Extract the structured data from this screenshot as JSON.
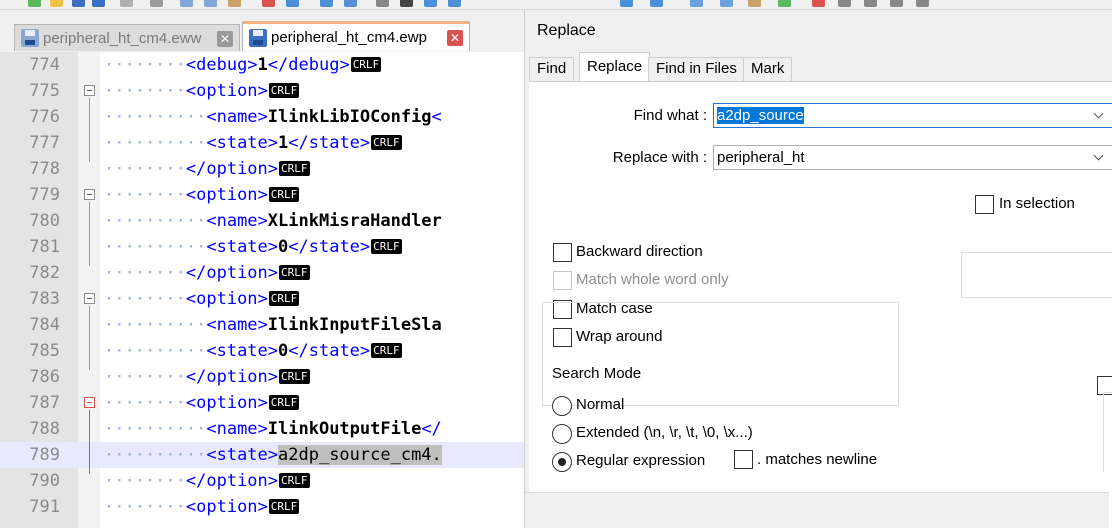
{
  "tabs": [
    {
      "label": "peripheral_ht_cm4.eww",
      "active": false
    },
    {
      "label": "peripheral_ht_cm4.ewp",
      "active": true
    }
  ],
  "editor": {
    "lines": [
      {
        "num": "774",
        "parts": [
          {
            "t": "dots",
            "v": "········"
          },
          {
            "t": "tag",
            "v": "<debug>"
          },
          {
            "t": "bold",
            "v": "1"
          },
          {
            "t": "tag",
            "v": "</debug>"
          },
          {
            "t": "crlf",
            "v": "CRLF"
          }
        ]
      },
      {
        "num": "775",
        "parts": [
          {
            "t": "dots",
            "v": "········"
          },
          {
            "t": "tag",
            "v": "<option>"
          },
          {
            "t": "crlf",
            "v": "CRLF"
          }
        ]
      },
      {
        "num": "776",
        "parts": [
          {
            "t": "dots",
            "v": "··········"
          },
          {
            "t": "tag",
            "v": "<name>"
          },
          {
            "t": "bold",
            "v": "IlinkLibIOConfig"
          },
          {
            "t": "tag",
            "v": "<"
          }
        ]
      },
      {
        "num": "777",
        "parts": [
          {
            "t": "dots",
            "v": "··········"
          },
          {
            "t": "tag",
            "v": "<state>"
          },
          {
            "t": "bold",
            "v": "1"
          },
          {
            "t": "tag",
            "v": "</state>"
          },
          {
            "t": "crlf",
            "v": "CRLF"
          }
        ]
      },
      {
        "num": "778",
        "parts": [
          {
            "t": "dots",
            "v": "········"
          },
          {
            "t": "tag",
            "v": "</option>"
          },
          {
            "t": "crlf",
            "v": "CRLF"
          }
        ]
      },
      {
        "num": "779",
        "parts": [
          {
            "t": "dots",
            "v": "········"
          },
          {
            "t": "tag",
            "v": "<option>"
          },
          {
            "t": "crlf",
            "v": "CRLF"
          }
        ]
      },
      {
        "num": "780",
        "parts": [
          {
            "t": "dots",
            "v": "··········"
          },
          {
            "t": "tag",
            "v": "<name>"
          },
          {
            "t": "bold",
            "v": "XLinkMisraHandler"
          }
        ]
      },
      {
        "num": "781",
        "parts": [
          {
            "t": "dots",
            "v": "··········"
          },
          {
            "t": "tag",
            "v": "<state>"
          },
          {
            "t": "bold",
            "v": "0"
          },
          {
            "t": "tag",
            "v": "</state>"
          },
          {
            "t": "crlf",
            "v": "CRLF"
          }
        ]
      },
      {
        "num": "782",
        "parts": [
          {
            "t": "dots",
            "v": "········"
          },
          {
            "t": "tag",
            "v": "</option>"
          },
          {
            "t": "crlf",
            "v": "CRLF"
          }
        ]
      },
      {
        "num": "783",
        "parts": [
          {
            "t": "dots",
            "v": "········"
          },
          {
            "t": "tag",
            "v": "<option>"
          },
          {
            "t": "crlf",
            "v": "CRLF"
          }
        ]
      },
      {
        "num": "784",
        "parts": [
          {
            "t": "dots",
            "v": "··········"
          },
          {
            "t": "tag",
            "v": "<name>"
          },
          {
            "t": "bold",
            "v": "IlinkInputFileSla"
          }
        ]
      },
      {
        "num": "785",
        "parts": [
          {
            "t": "dots",
            "v": "··········"
          },
          {
            "t": "tag",
            "v": "<state>"
          },
          {
            "t": "bold",
            "v": "0"
          },
          {
            "t": "tag",
            "v": "</state>"
          },
          {
            "t": "crlf",
            "v": "CRLF"
          }
        ]
      },
      {
        "num": "786",
        "parts": [
          {
            "t": "dots",
            "v": "········"
          },
          {
            "t": "tag",
            "v": "</option>"
          },
          {
            "t": "crlf",
            "v": "CRLF"
          }
        ]
      },
      {
        "num": "787",
        "parts": [
          {
            "t": "dots",
            "v": "········"
          },
          {
            "t": "tag",
            "v": "<option>"
          },
          {
            "t": "crlf",
            "v": "CRLF"
          }
        ]
      },
      {
        "num": "788",
        "parts": [
          {
            "t": "dots",
            "v": "··········"
          },
          {
            "t": "tag",
            "v": "<name>"
          },
          {
            "t": "bold",
            "v": "IlinkOutputFile"
          },
          {
            "t": "tag",
            "v": "</"
          }
        ]
      },
      {
        "num": "789",
        "parts": [
          {
            "t": "dots",
            "v": "··········"
          },
          {
            "t": "tag",
            "v": "<state>"
          },
          {
            "t": "hl",
            "v": "a2dp_source_cm4."
          }
        ]
      },
      {
        "num": "790",
        "parts": [
          {
            "t": "dots",
            "v": "········"
          },
          {
            "t": "tag",
            "v": "</option>"
          },
          {
            "t": "crlf",
            "v": "CRLF"
          }
        ]
      },
      {
        "num": "791",
        "parts": [
          {
            "t": "dots",
            "v": "········"
          },
          {
            "t": "tag",
            "v": "<option>"
          },
          {
            "t": "crlf",
            "v": "CRLF"
          }
        ]
      }
    ]
  },
  "dialog": {
    "title": "Replace",
    "tabs": [
      "Find",
      "Replace",
      "Find in Files",
      "Mark"
    ],
    "find_label": "Find what :",
    "find_value": "a2dp_source",
    "replace_label": "Replace with :",
    "replace_value": "peripheral_ht",
    "in_selection": "In selection",
    "backward": "Backward direction",
    "whole_word": "Match whole word only",
    "match_case": "Match case",
    "wrap_around": "Wrap around",
    "search_mode": "Search Mode",
    "mode_normal": "Normal",
    "mode_extended": "Extended (\\n, \\r, \\t, \\0, \\x...)",
    "mode_regex": "Regular expression",
    "matches_newline": ". matches newline"
  }
}
